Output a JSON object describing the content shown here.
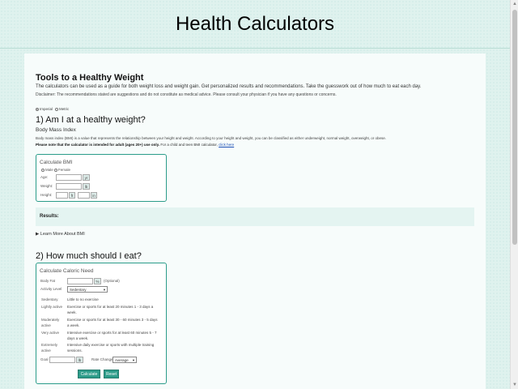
{
  "header": {
    "title": "Health Calculators"
  },
  "intro": {
    "title": "Tools to a Healthy Weight",
    "text": "The calculators can be used as a guide for both weight loss and weight gain. Get personalized results and recommendations. Take the guesswork out of how much to eat each day.",
    "disclaimer": "Disclaimer: The recommendations stated are suggestions and do not constitute as medical advice. Please consult your physician if you have any questions or concerns."
  },
  "units": {
    "imperial": "Imperial",
    "metric": "Metric",
    "selected": "imperial"
  },
  "bmi": {
    "heading": "1) Am I at a healthy weight?",
    "subheading": "Body Mass Index",
    "description": "Body mass index (BMI) is a value that represents the relationship between your height and weight. According to your height and weight, you can be classified as either underweight, normal weight, overweight, or obese.",
    "note_bold": "Please note that the calculator is intended for adult (ages 20+) use only.",
    "note_rest": " For a child and teen BMI calculator,",
    "link": "click here",
    "card_title": "Calculate BMI",
    "male": "Male",
    "female": "Female",
    "age_label": "Age:",
    "age_unit": "yr",
    "weight_label": "Weight:",
    "weight_unit": "lb",
    "height_label": "Height:",
    "height_ft": "ft",
    "height_in": "in"
  },
  "results": {
    "label": "Results:"
  },
  "learn_more": "Learn More About BMI",
  "caloric": {
    "heading": "2) How much should I eat?",
    "card_title": "Calculate Caloric Need",
    "bodyfat_label": "Body Fat",
    "bodyfat_unit": "%",
    "optional": "(Optional)",
    "activity_label": "Activity Level",
    "activity_selected": "Sedentary",
    "activities": [
      {
        "name": "Sedentary",
        "desc": "Little to no exercise"
      },
      {
        "name": "Lightly active",
        "desc": "Exercise or sports for at least 20 minutes 1 - 3 days a week."
      },
      {
        "name": "Moderately active",
        "desc": "Exercise or sports for at least 30 - 60 minutes 3 - 5 days a week."
      },
      {
        "name": "Very active",
        "desc": "Intensive exercise or sports for at least 60 minutes 5 - 7 days a week."
      },
      {
        "name": "Extremely active",
        "desc": "Intensive daily exercise or sports with multiple training sessions."
      }
    ],
    "goal_label": "Goal",
    "goal_unit": "lb",
    "rate_label": "Rate Change",
    "rate_selected": "Average",
    "calculate": "Calculate",
    "reset": "Reset"
  },
  "colors": {
    "accent": "#2e9c8a",
    "background": "#dff2ee",
    "panel": "#f7fcfb"
  }
}
